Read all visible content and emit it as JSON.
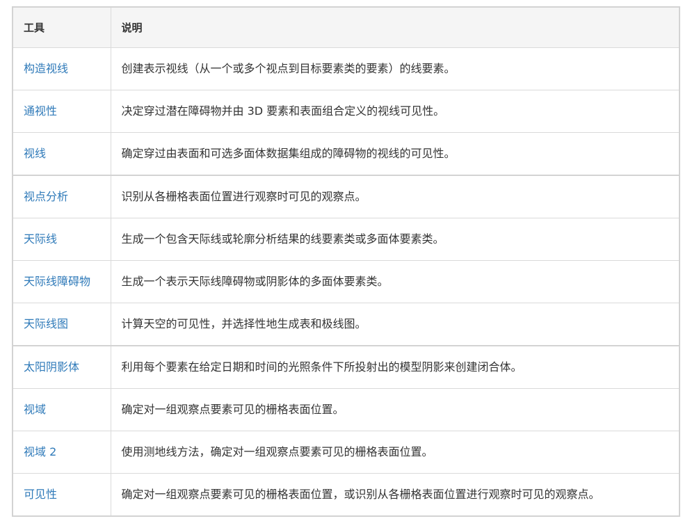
{
  "table": {
    "headers": {
      "tool": "工具",
      "description": "说明"
    },
    "rows": [
      {
        "tool": "构造视线",
        "description": "创建表示视线（从一个或多个视点到目标要素类的要素）的线要素。"
      },
      {
        "tool": "通视性",
        "description": "决定穿过潜在障碍物并由 3D 要素和表面组合定义的视线可见性。"
      },
      {
        "tool": "视线",
        "description": "确定穿过由表面和可选多面体数据集组成的障碍物的视线的可见性。"
      },
      {
        "tool": "视点分析",
        "description": "识别从各栅格表面位置进行观察时可见的观察点。"
      },
      {
        "tool": "天际线",
        "description": "生成一个包含天际线或轮廓分析结果的线要素类或多面体要素类。"
      },
      {
        "tool": "天际线障碍物",
        "description": "生成一个表示天际线障碍物或阴影体的多面体要素类。"
      },
      {
        "tool": "天际线图",
        "description": "计算天空的可见性，并选择性地生成表和极线图。"
      },
      {
        "tool": "太阳阴影体",
        "description": "利用每个要素在给定日期和时间的光照条件下所投射出的模型阴影来创建闭合体。"
      },
      {
        "tool": "视域",
        "description": "确定对一组观察点要素可见的栅格表面位置。"
      },
      {
        "tool": "视域 2",
        "description": "使用测地线方法，确定对一组观察点要素可见的栅格表面位置。"
      },
      {
        "tool": "可见性",
        "description": "确定对一组观察点要素可见的栅格表面位置，或识别从各栅格表面位置进行观察时可见的观察点。"
      }
    ]
  }
}
